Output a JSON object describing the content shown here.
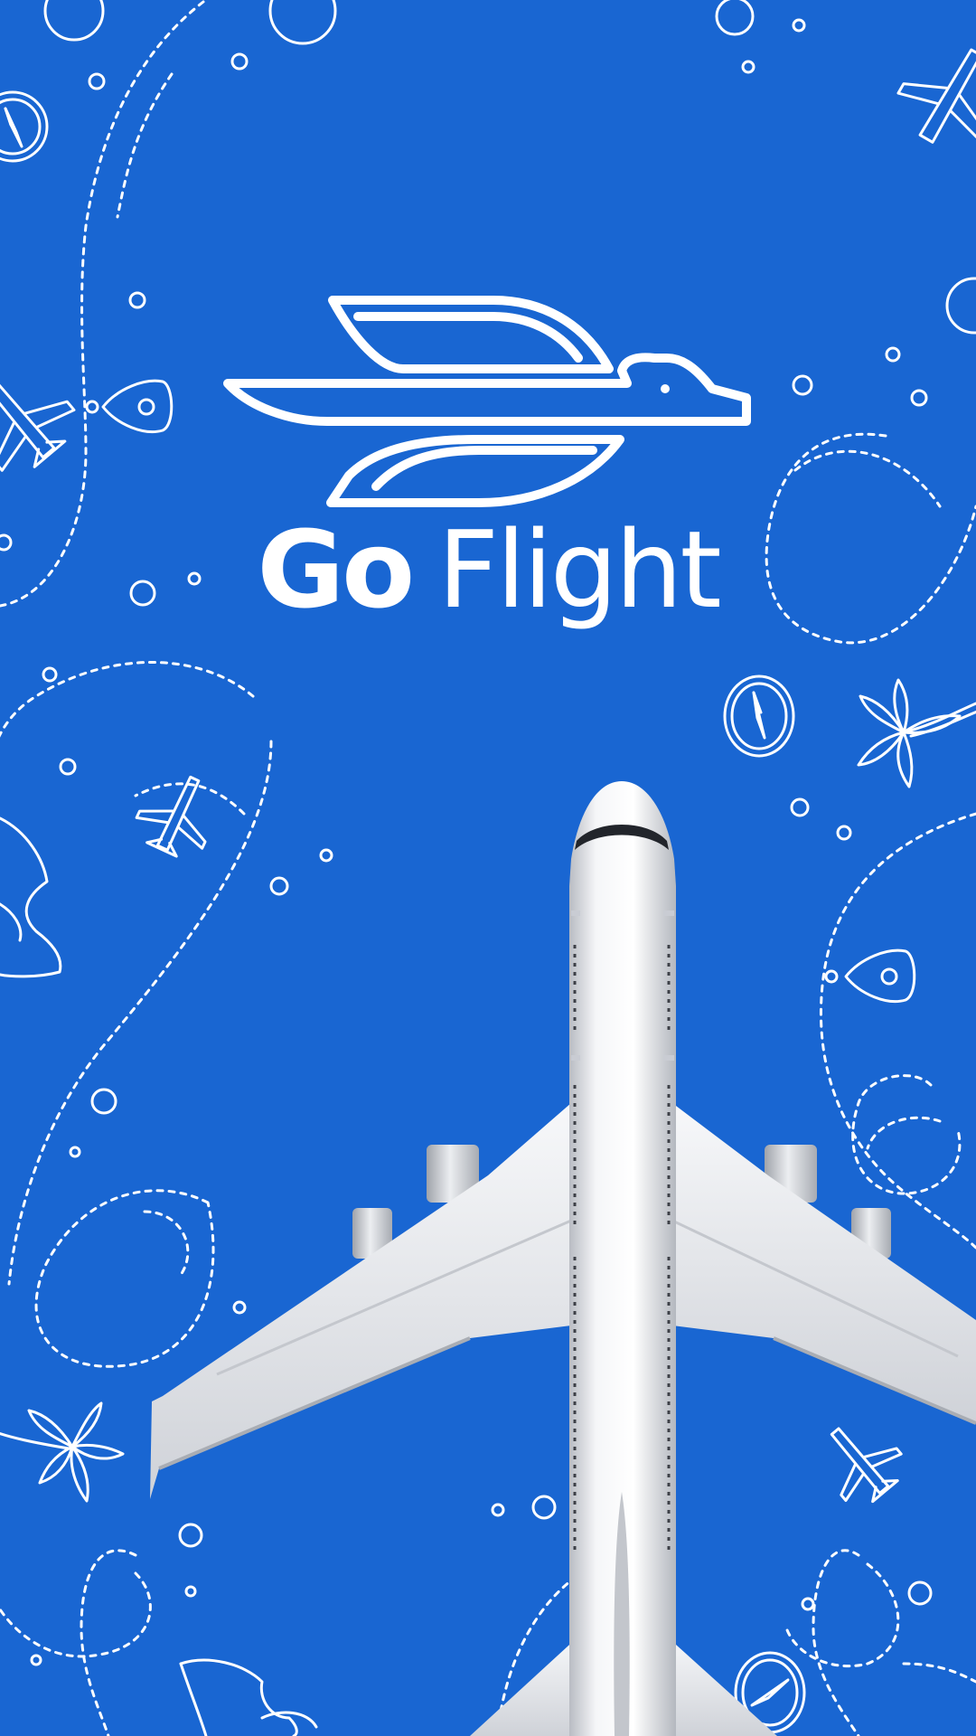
{
  "splash": {
    "brand_bold": "Go",
    "brand_light": "Flight"
  },
  "colors": {
    "background": "#1966d2",
    "line_art": "#ffffff",
    "fuselage": "#f2f3f6",
    "wing_shade": "#c9ccd3"
  },
  "icons": [
    "bird-logo-icon",
    "airplane-doodle-icon",
    "compass-icon",
    "location-pin-icon",
    "palm-tree-icon",
    "world-map-icon"
  ]
}
